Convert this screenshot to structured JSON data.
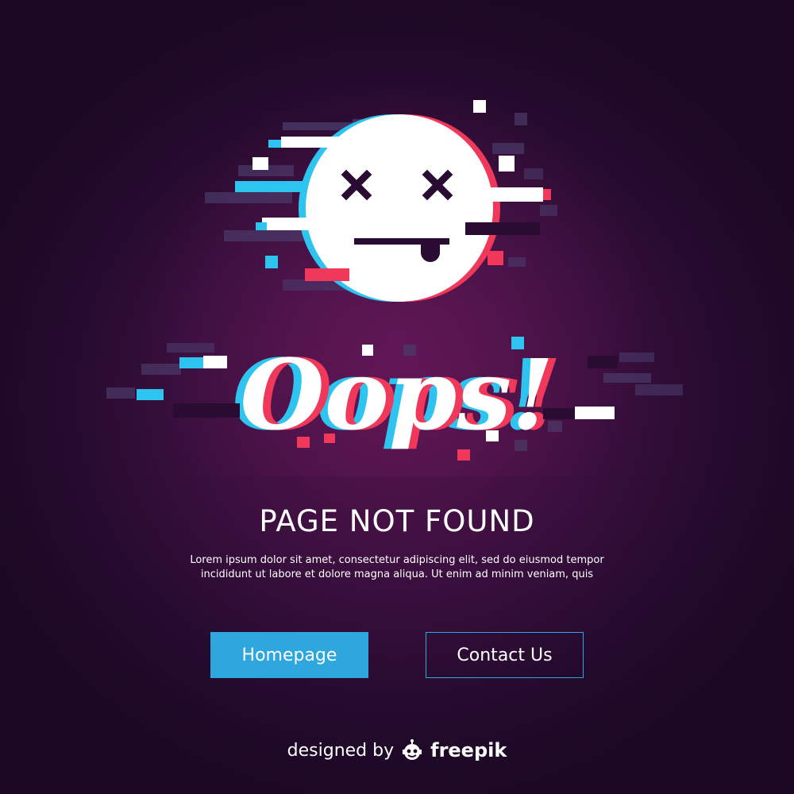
{
  "hero": {
    "glitch_text": "Oops!"
  },
  "title": "PAGE NOT FOUND",
  "description": {
    "line1": "Lorem ipsum dolor sit amet, consectetur adipiscing elit, sed do eiusmod tempor",
    "line2": "incididunt ut labore et dolore magna aliqua. Ut enim ad minim veniam, quis"
  },
  "buttons": {
    "homepage": "Homepage",
    "contact": "Contact Us"
  },
  "credit": {
    "prefix": "designed by",
    "brand": "freepik",
    "icon": "freepik-logo-icon"
  },
  "colors": {
    "accent": "#2ea6de",
    "glitch_cyan": "#2ec4f0",
    "glitch_red": "#f0385a",
    "background": "#2a0c33"
  }
}
